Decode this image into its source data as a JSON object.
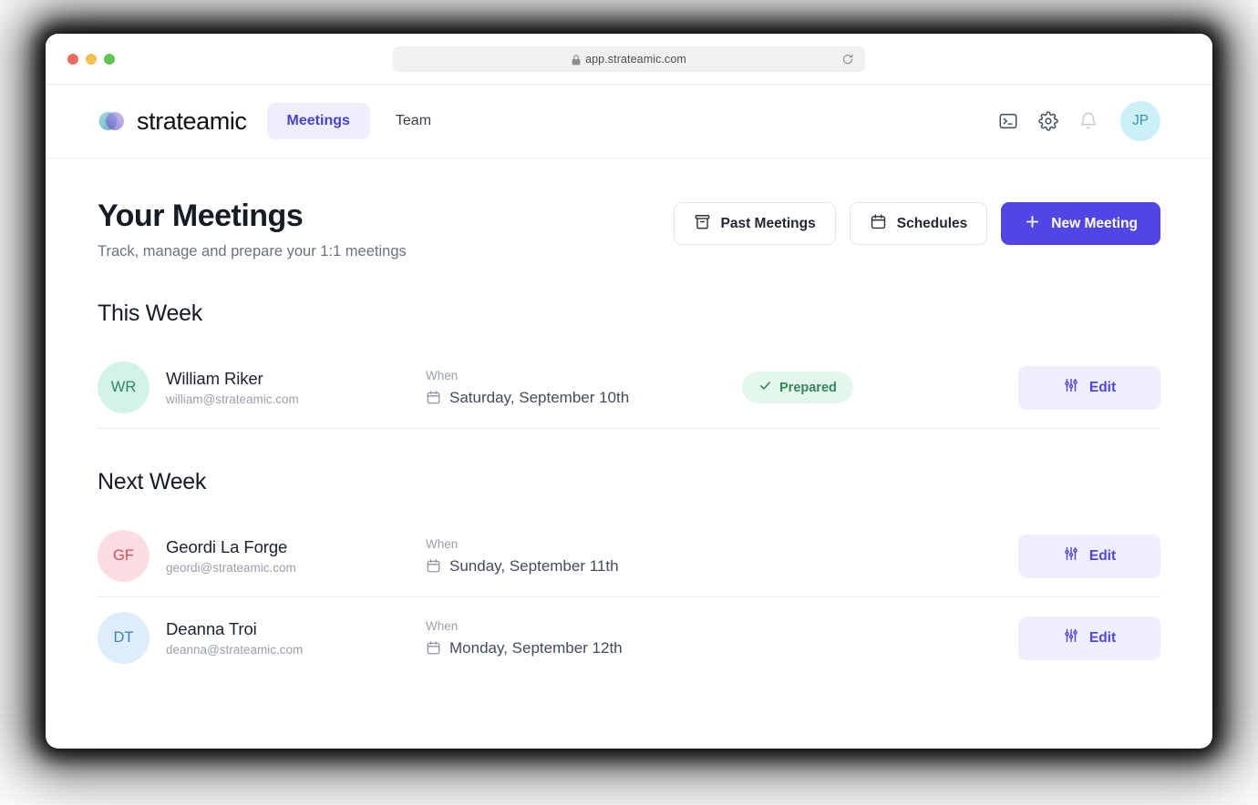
{
  "browser": {
    "url": "app.strateamic.com",
    "lock_icon": "lock-icon",
    "reload_icon": "reload-icon",
    "traffic_lights": [
      "close-red",
      "minimize-yellow",
      "maximize-green"
    ]
  },
  "header": {
    "brand_name": "strateamic",
    "logo_icon": "strateamic-logo",
    "nav": [
      {
        "label": "Meetings",
        "active": true
      },
      {
        "label": "Team",
        "active": false
      }
    ],
    "actions": [
      {
        "icon": "terminal-icon",
        "name": "terminal-button"
      },
      {
        "icon": "gear-icon",
        "name": "settings-button"
      },
      {
        "icon": "bell-icon",
        "name": "notifications-button"
      }
    ],
    "avatar_initials": "JP"
  },
  "page": {
    "title": "Your Meetings",
    "subtitle": "Track, manage and prepare your 1:1 meetings",
    "buttons": [
      {
        "label": "Past Meetings",
        "icon": "archive-icon",
        "style": "secondary"
      },
      {
        "label": "Schedules",
        "icon": "calendar-icon",
        "style": "secondary"
      },
      {
        "label": "New Meeting",
        "icon": "plus-icon",
        "style": "primary"
      }
    ]
  },
  "sections": [
    {
      "title": "This Week",
      "rows": [
        {
          "initials": "WR",
          "avatar_color": "mint",
          "name": "William Riker",
          "email": "william@strateamic.com",
          "when_label": "When",
          "when_value": "Saturday, September 10th",
          "status": "Prepared",
          "has_status": true,
          "edit_label": "Edit"
        }
      ]
    },
    {
      "title": "Next Week",
      "rows": [
        {
          "initials": "GF",
          "avatar_color": "rose",
          "name": "Geordi La Forge",
          "email": "geordi@strateamic.com",
          "when_label": "When",
          "when_value": "Sunday, September 11th",
          "status": "",
          "has_status": false,
          "edit_label": "Edit"
        },
        {
          "initials": "DT",
          "avatar_color": "sky",
          "name": "Deanna Troi",
          "email": "deanna@strateamic.com",
          "when_label": "When",
          "when_value": "Monday, September 12th",
          "status": "",
          "has_status": false,
          "edit_label": "Edit"
        }
      ]
    }
  ],
  "colors": {
    "accent": "#4f46e5",
    "accent_soft": "#eeeefc",
    "badge_green_bg": "#e4f7ec",
    "badge_green_text": "#35875b",
    "avatar_mint": "#d2f4e8",
    "avatar_rose": "#fcdde1",
    "avatar_sky": "#ddedfb",
    "avatar_jp": "#cbf0f8"
  }
}
